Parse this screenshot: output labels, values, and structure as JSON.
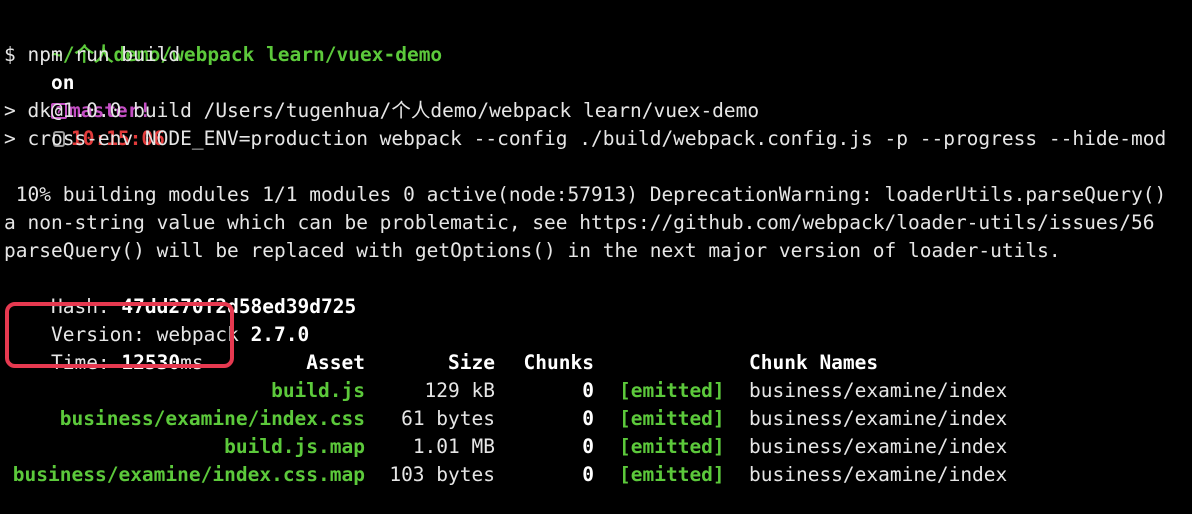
{
  "prompt": {
    "path": "~/个人demo/webpack learn/vuex-demo",
    "on": "on",
    "branch": "master!",
    "time": "10:15:06",
    "watch_icon": "watch-icon",
    "git_icon": "git-status-icon"
  },
  "command": "$ npm run build",
  "script_lines": [
    "> dk@1.0.0 build /Users/tugenhua/个人demo/webpack learn/vuex-demo",
    "> cross-env NODE_ENV=production webpack --config ./build/webpack.config.js -p --progress --hide-mod"
  ],
  "warning_lines": [
    " 10% building modules 1/1 modules 0 active(node:57913) DeprecationWarning: loaderUtils.parseQuery()",
    "a non-string value which can be problematic, see https://github.com/webpack/loader-utils/issues/56",
    "parseQuery() will be replaced with getOptions() in the next major version of loader-utils."
  ],
  "hash": {
    "label": "Hash: ",
    "value": "47dd270f2d58ed39d725"
  },
  "version": {
    "label": "Version: webpack ",
    "value": "2.7.0"
  },
  "time_stat": {
    "label": "Time: ",
    "value": "12530",
    "unit": "ms"
  },
  "table": {
    "headers": {
      "asset": "Asset",
      "size": "Size",
      "chunks": "Chunks",
      "chunk_names": "Chunk Names"
    },
    "rows": [
      {
        "asset": "build.js",
        "size": "129 kB",
        "chunks": "0",
        "emitted": "[emitted]",
        "chunk_names": "business/examine/index"
      },
      {
        "asset": "business/examine/index.css",
        "size": "61 bytes",
        "chunks": "0",
        "emitted": "[emitted]",
        "chunk_names": "business/examine/index"
      },
      {
        "asset": "build.js.map",
        "size": "1.01 MB",
        "chunks": "0",
        "emitted": "[emitted]",
        "chunk_names": "business/examine/index"
      },
      {
        "asset": "business/examine/index.css.map",
        "size": "103 bytes",
        "chunks": "0",
        "emitted": "[emitted]",
        "chunk_names": "business/examine/index"
      }
    ]
  },
  "colors": {
    "background": "#000000",
    "path_green": "#5cc93b",
    "branch_purple": "#c44fc4",
    "time_red": "#e23b3b",
    "highlight_red": "#e63950"
  }
}
